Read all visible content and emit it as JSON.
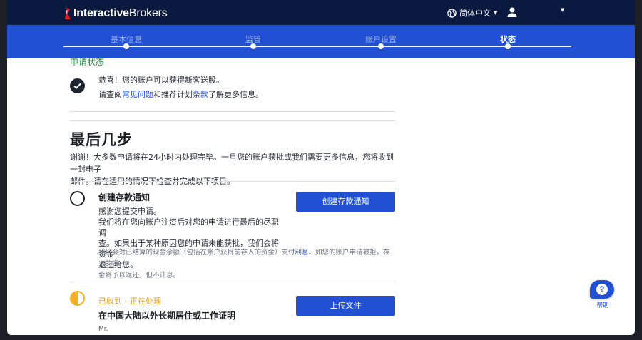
{
  "header": {
    "brand_bold": "Interactive",
    "brand_light": "Brokers",
    "language": "简体中文",
    "icons": {
      "logo": "ib-logo-icon",
      "globe": "globe-icon",
      "user": "user-icon",
      "caret": "caret-down-icon"
    }
  },
  "steps": [
    {
      "label": "基本信息",
      "active": false
    },
    {
      "label": "监管",
      "active": false
    },
    {
      "label": "账户设置",
      "active": false
    },
    {
      "label": "状态",
      "active": true
    }
  ],
  "status": {
    "title": "申请状态",
    "congrats": "恭喜！您的账户可以获得新客送股。",
    "info_prefix": "请查阅",
    "faq_link": "常见问题",
    "info_mid": "和推荐计划",
    "terms_link": "条款",
    "info_suffix": "了解更多信息。"
  },
  "final_steps": {
    "heading": "最后几步",
    "intro_line1": "谢谢！大多数申请将在24小时内处理完毕。一旦您的账户获批或我们需要更多信息，您将收到一封电子",
    "intro_line2": "邮件。请在适用的情况下检查并完成以下项目。"
  },
  "deposit": {
    "title": "创建存款通知",
    "body_line1": "感谢您提交申请。",
    "body_line2": "我们将在您向账户注资后对您的申请进行最后的尽职调",
    "body_line3": "查。如果出于某种原因您的申请未能获批，我们会将资金",
    "body_line4": "退还给您。",
    "note_prefix": "我们会对已结算的现金余额（包括在账户获批前存入的资金）支付",
    "note_link": "利息",
    "note_suffix": "。如您的账户申请被拒，存入的资",
    "note_line2": "金将予以返还，但不计息。",
    "button": "创建存款通知"
  },
  "residence": {
    "status": "已收到 - 正在处理",
    "title": "在中国大陆以外长期居住或工作证明",
    "partial_text": "Mr.",
    "button": "上传文件"
  },
  "help": {
    "label": "帮助",
    "icon": "help-bubble-icon"
  },
  "colors": {
    "navy": "#09193f",
    "blue": "#2150d3",
    "green": "#1f8a3b",
    "amber": "#e9a21a"
  }
}
